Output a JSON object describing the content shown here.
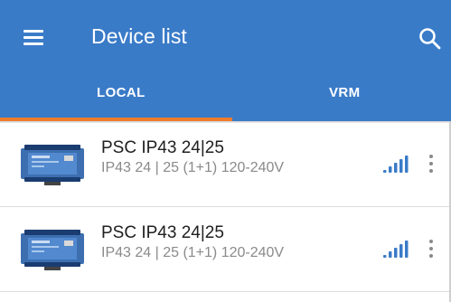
{
  "header": {
    "title": "Device list",
    "menu_icon": "hamburger-menu-icon",
    "search_icon": "search-icon",
    "background_color": "#3a7bc8"
  },
  "tabs": [
    {
      "label": "LOCAL",
      "selected": true
    },
    {
      "label": "VRM",
      "selected": false
    }
  ],
  "tab_indicator_color": "#f07c2e",
  "devices": [
    {
      "name": "PSC IP43 24|25",
      "description": "IP43 24 | 25 (1+1) 120-240V",
      "signal_icon": "signal-strength-icon",
      "menu_icon": "more-vert-icon"
    },
    {
      "name": "PSC IP43 24|25",
      "description": "IP43 24 | 25 (1+1) 120-240V",
      "signal_icon": "signal-strength-icon",
      "menu_icon": "more-vert-icon"
    }
  ]
}
